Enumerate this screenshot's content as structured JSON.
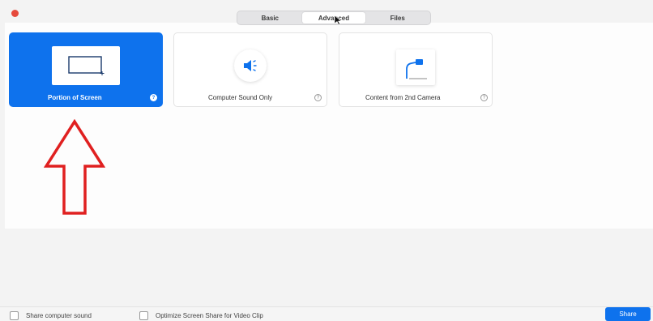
{
  "tabs": [
    {
      "label": "Basic",
      "active": false
    },
    {
      "label": "Advanced",
      "active": true
    },
    {
      "label": "Files",
      "active": false
    }
  ],
  "options": [
    {
      "label": "Portion of Screen",
      "icon": "portion-of-screen-icon",
      "selected": true
    },
    {
      "label": "Computer Sound Only",
      "icon": "speaker-icon",
      "selected": false
    },
    {
      "label": "Content from 2nd Camera",
      "icon": "camera-icon",
      "selected": false
    }
  ],
  "help_glyph": "?",
  "annotation": {
    "icon": "red-up-arrow-icon",
    "color": "#e02020"
  },
  "footer": {
    "share_sound_label": "Share computer sound",
    "optimize_label": "Optimize Screen Share for Video Clip",
    "share_button_label": "Share"
  },
  "colors": {
    "accent": "#0e72ed",
    "close": "#e64a3c"
  }
}
